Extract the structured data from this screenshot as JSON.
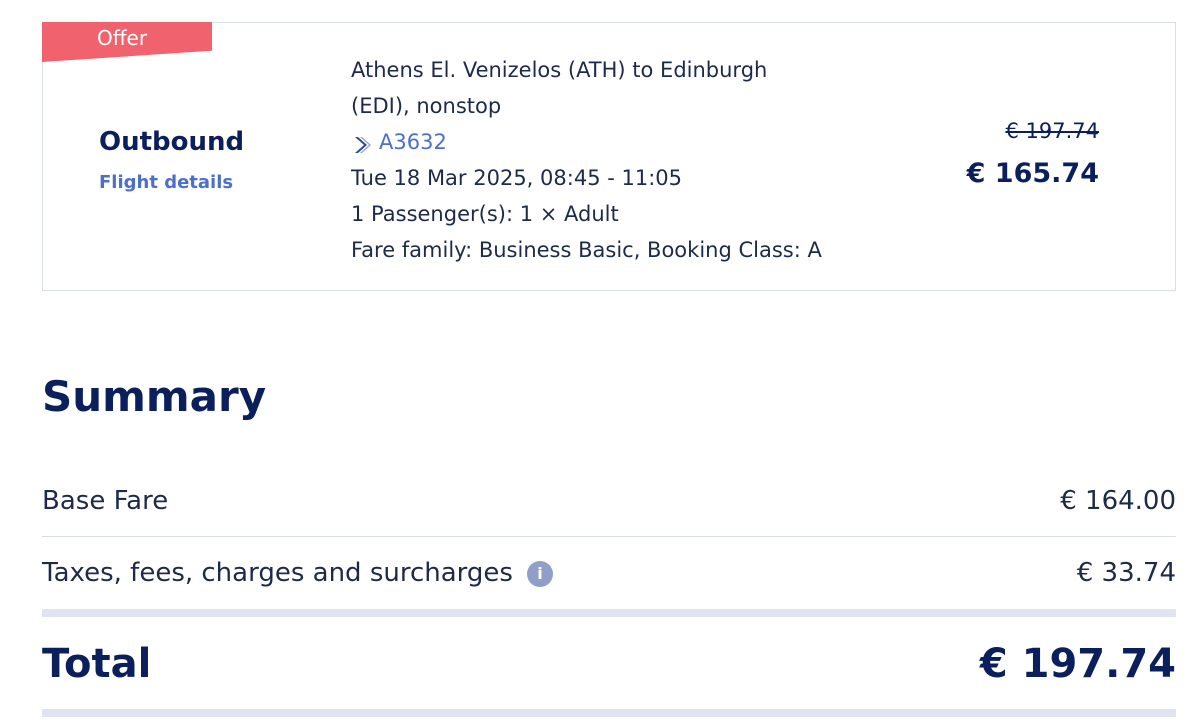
{
  "outbound_card": {
    "badge": "Offer",
    "direction": "Outbound",
    "details_link": "Flight details",
    "route_line1": "Athens El. Venizelos (ATH) to Edinburgh",
    "route_line2": "(EDI), nonstop",
    "flight_number": "A3632",
    "airline_icon": "aegean-airlines-icon",
    "datetime": "Tue 18 Mar 2025, 08:45 - 11:05",
    "passengers": "1 Passenger(s): 1 × Adult",
    "fare": "Fare family: Business Basic, Booking Class: A",
    "original_price": "€ 197.74",
    "offer_price": "€ 165.74"
  },
  "summary": {
    "title": "Summary",
    "base_fare_label": "Base Fare",
    "base_fare_value": "€ 164.00",
    "taxes_label": "Taxes, fees, charges and surcharges",
    "taxes_value": "€ 33.74",
    "info_icon": "info-icon",
    "total_label": "Total",
    "total_value": "€ 197.74"
  },
  "colors": {
    "primary_navy": "#0b1f5c",
    "link_blue": "#4c70c8",
    "offer_red": "#f0636e",
    "divider": "#dfe4f0"
  }
}
